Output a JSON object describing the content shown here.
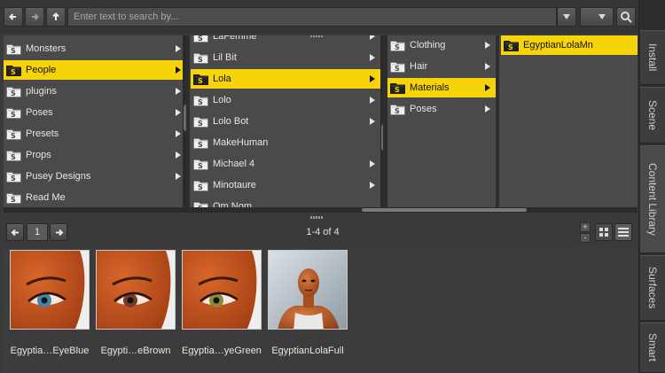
{
  "toolbar": {
    "back_icon": "arrow-left-icon",
    "forward_icon": "arrow-right-icon",
    "up_icon": "arrow-up-icon",
    "search_placeholder": "Enter text to search by...",
    "filter_dropdown_icon": "chevron-down-icon",
    "options_dropdown_icon": "chevron-down-icon",
    "search_button_icon": "magnifier-icon"
  },
  "right_tabs": [
    {
      "label": "Install"
    },
    {
      "label": "Scene"
    },
    {
      "label": "Content Library",
      "active": true
    },
    {
      "label": "Surfaces"
    },
    {
      "label": "Smart"
    }
  ],
  "columns": [
    {
      "items": [
        {
          "label": "Monsters",
          "has_children": true
        },
        {
          "label": "People",
          "has_children": true,
          "selected": true
        },
        {
          "label": "plugins",
          "has_children": true
        },
        {
          "label": "Poses",
          "has_children": true
        },
        {
          "label": "Presets",
          "has_children": true
        },
        {
          "label": "Props",
          "has_children": true
        },
        {
          "label": "Pusey Designs",
          "has_children": true
        },
        {
          "label": "Read Me",
          "has_children": false
        }
      ]
    },
    {
      "items": [
        {
          "label": "LaFemme",
          "has_children": true
        },
        {
          "label": "Lil Bit",
          "has_children": true
        },
        {
          "label": "Lola",
          "has_children": true,
          "selected": true
        },
        {
          "label": "Lolo",
          "has_children": true
        },
        {
          "label": "Lolo Bot",
          "has_children": true
        },
        {
          "label": "MakeHuman",
          "has_children": false
        },
        {
          "label": "Michael 4",
          "has_children": true
        },
        {
          "label": "Minotaure",
          "has_children": true
        },
        {
          "label": "Om Nom",
          "has_children": false
        }
      ]
    },
    {
      "items": [
        {
          "label": "Clothing",
          "has_children": true
        },
        {
          "label": "Hair",
          "has_children": true
        },
        {
          "label": "Materials",
          "has_children": true,
          "selected": true
        },
        {
          "label": "Poses",
          "has_children": true
        }
      ]
    },
    {
      "items": [
        {
          "label": "EgyptianLolaMn",
          "has_children": false,
          "selected": true
        }
      ]
    }
  ],
  "pager": {
    "prev_icon": "arrow-left-icon",
    "page": "1",
    "next_icon": "arrow-right-icon",
    "count": "1-4 of 4",
    "zoom_in": "+",
    "zoom_out": "-",
    "view_grid_icon": "grid-view-icon",
    "view_list_icon": "list-view-icon",
    "active_view": "list"
  },
  "thumbnails": [
    {
      "label": "Egyptia…EyeBlue",
      "iris_color": "#3f86a8"
    },
    {
      "label": "Egypti…eBrown",
      "iris_color": "#7a3a2a"
    },
    {
      "label": "Egyptia…yeGreen",
      "iris_color": "#8a8a3a"
    },
    {
      "label": "EgyptianLolaFull",
      "iris_color": ""
    }
  ],
  "colors": {
    "selection": "#f7d40a",
    "skin": "#c0501c"
  }
}
